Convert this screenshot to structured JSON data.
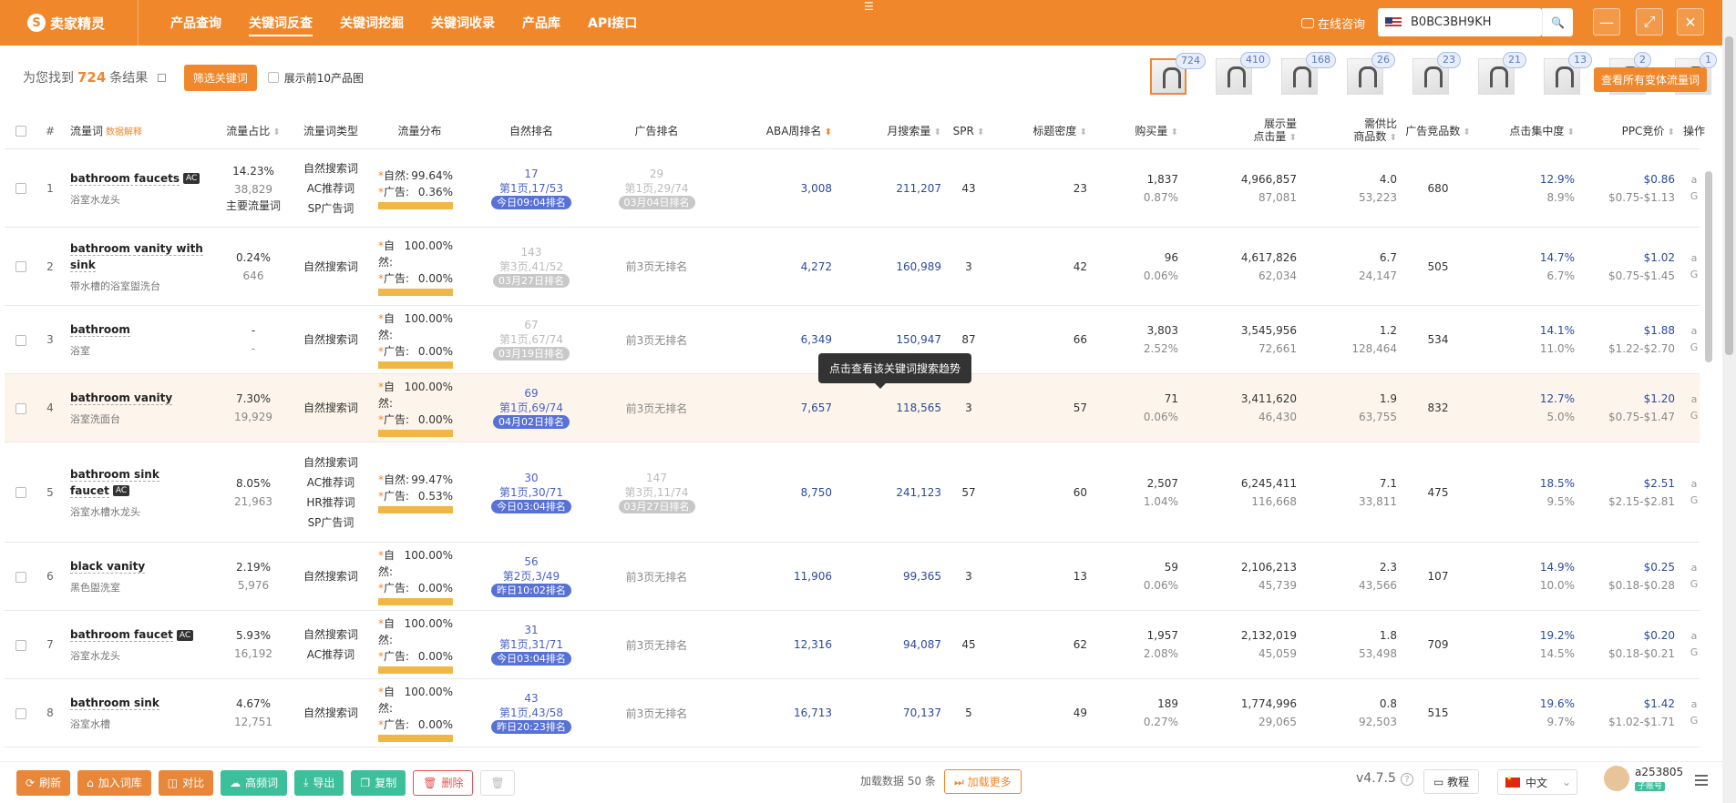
{
  "app": {
    "logo_text": "卖家精灵",
    "logo_mark": "S"
  },
  "nav": [
    {
      "label": "产品查询"
    },
    {
      "label": "关键词反查"
    },
    {
      "label": "关键词挖掘"
    },
    {
      "label": "关键词收录"
    },
    {
      "label": "产品库"
    },
    {
      "label": "API接口"
    }
  ],
  "topbar": {
    "consult": "在线咨询",
    "asin": "B0BC3BH9KH"
  },
  "summary": {
    "prefix": "为您找到",
    "count": "724",
    "suffix": "条结果",
    "filter_btn": "筛选关键词",
    "top10_label": "展示前10产品图",
    "view_all_btn": "查看所有变体流量词",
    "thumb_counts": [
      "724",
      "410",
      "168",
      "26",
      "23",
      "21",
      "13",
      "2",
      "1"
    ]
  },
  "headers": {
    "num": "#",
    "kw": "流量词",
    "kw_link": "数据解释",
    "share": "流量占比",
    "type": "流量词类型",
    "dist": "流量分布",
    "nat": "自然排名",
    "ad": "广告排名",
    "aba": "ABA周排名",
    "month": "月搜索量",
    "spr": "SPR",
    "title": "标题密度",
    "buy": "购买量",
    "imp1": "展示量",
    "imp2": "点击量",
    "supply1": "需供比",
    "supply2": "商品数",
    "adprod": "广告竞品数",
    "click": "点击集中度",
    "ppc": "PPC竞价",
    "op": "操作"
  },
  "dist_labels": {
    "nat": "自然:",
    "ad": "广告:"
  },
  "rows": [
    {
      "num": "1",
      "kw": "bathroom faucets",
      "ac": true,
      "kw_cn": "浴室水龙头",
      "share1": "14.23%",
      "share2": "38,829",
      "share3": "主要流量词",
      "types": [
        "自然搜索词",
        "AC推荐词",
        "SP广告词"
      ],
      "dist_nat": "99.64%",
      "dist_ad": "0.36%",
      "nat_rank": "17",
      "nat_page": "第1页,17/53",
      "nat_pill": "今日09:04排名",
      "ad_rank": "29",
      "ad_page": "第1页,29/74",
      "ad_pill": "03月04日排名",
      "ad_none": "",
      "aba": "3,008",
      "month": "211,207",
      "spr": "43",
      "title": "23",
      "buy1": "1,837",
      "buy2": "0.87%",
      "imp1": "4,966,857",
      "imp2": "87,081",
      "sup1": "4.0",
      "sup2": "53,223",
      "adprod": "680",
      "click1": "12.9%",
      "click2": "8.9%",
      "ppc1": "$0.86",
      "ppc2": "$0.75-$1.13"
    },
    {
      "num": "2",
      "kw": "bathroom vanity with sink",
      "ac": false,
      "kw_cn": "带水槽的浴室盥洗台",
      "share1": "0.24%",
      "share2": "646",
      "share3": "",
      "types": [
        "自然搜索词"
      ],
      "dist_nat": "100.00%",
      "dist_ad": "0.00%",
      "nat_rank": "143",
      "nat_page": "第3页,41/52",
      "nat_pill": "03月27日排名",
      "nat_grey": true,
      "ad_rank": "",
      "ad_page": "",
      "ad_pill": "",
      "ad_none": "前3页无排名",
      "aba": "4,272",
      "month": "160,989",
      "spr": "3",
      "title": "42",
      "buy1": "96",
      "buy2": "0.06%",
      "imp1": "4,617,826",
      "imp2": "62,034",
      "sup1": "6.7",
      "sup2": "24,147",
      "adprod": "505",
      "click1": "14.7%",
      "click2": "6.7%",
      "ppc1": "$1.02",
      "ppc2": "$0.75-$1.45"
    },
    {
      "num": "3",
      "kw": "bathroom",
      "ac": false,
      "kw_cn": "浴室",
      "share1": "-",
      "share2": "-",
      "share3": "",
      "types": [
        "自然搜索词"
      ],
      "dist_nat": "100.00%",
      "dist_ad": "0.00%",
      "nat_rank": "67",
      "nat_page": "第1页,67/74",
      "nat_pill": "03月19日排名",
      "nat_grey": true,
      "ad_rank": "",
      "ad_page": "",
      "ad_pill": "",
      "ad_none": "前3页无排名",
      "aba": "6,349",
      "month": "150,947",
      "spr": "87",
      "title": "66",
      "buy1": "3,803",
      "buy2": "2.52%",
      "imp1": "3,545,956",
      "imp2": "72,661",
      "sup1": "1.2",
      "sup2": "128,464",
      "adprod": "534",
      "click1": "14.1%",
      "click2": "11.0%",
      "ppc1": "$1.88",
      "ppc2": "$1.22-$2.70"
    },
    {
      "num": "4",
      "kw": "bathroom vanity",
      "ac": false,
      "kw_cn": "浴室洗面台",
      "share1": "7.30%",
      "share2": "19,929",
      "share3": "",
      "types": [
        "自然搜索词"
      ],
      "dist_nat": "100.00%",
      "dist_ad": "0.00%",
      "nat_rank": "69",
      "nat_page": "第1页,69/74",
      "nat_pill": "04月02日排名",
      "ad_rank": "",
      "ad_page": "",
      "ad_pill": "",
      "ad_none": "前3页无排名",
      "aba": "7,657",
      "month": "118,565",
      "spr": "3",
      "title": "57",
      "buy1": "71",
      "buy2": "0.06%",
      "imp1": "3,411,620",
      "imp2": "46,430",
      "sup1": "1.9",
      "sup2": "63,755",
      "adprod": "832",
      "click1": "12.7%",
      "click2": "5.0%",
      "ppc1": "$1.20",
      "ppc2": "$0.75-$1.47"
    },
    {
      "num": "5",
      "kw": "bathroom sink faucet",
      "ac": true,
      "kw_cn": "浴室水槽水龙头",
      "share1": "8.05%",
      "share2": "21,963",
      "share3": "",
      "types": [
        "自然搜索词",
        "AC推荐词",
        "HR推荐词",
        "SP广告词"
      ],
      "dist_nat": "99.47%",
      "dist_ad": "0.53%",
      "nat_rank": "30",
      "nat_page": "第1页,30/71",
      "nat_pill": "今日03:04排名",
      "ad_rank": "147",
      "ad_page": "第3页,11/74",
      "ad_pill": "03月27日排名",
      "ad_none": "",
      "aba": "8,750",
      "month": "241,123",
      "spr": "57",
      "title": "60",
      "buy1": "2,507",
      "buy2": "1.04%",
      "imp1": "6,245,411",
      "imp2": "116,668",
      "sup1": "7.1",
      "sup2": "33,811",
      "adprod": "475",
      "click1": "18.5%",
      "click2": "9.5%",
      "ppc1": "$2.51",
      "ppc2": "$2.15-$2.81"
    },
    {
      "num": "6",
      "kw": "black vanity",
      "ac": false,
      "kw_cn": "黑色盥洗室",
      "share1": "2.19%",
      "share2": "5,976",
      "share3": "",
      "types": [
        "自然搜索词"
      ],
      "dist_nat": "100.00%",
      "dist_ad": "0.00%",
      "nat_rank": "56",
      "nat_page": "第2页,3/49",
      "nat_pill": "昨日10:02排名",
      "ad_rank": "",
      "ad_page": "",
      "ad_pill": "",
      "ad_none": "前3页无排名",
      "aba": "11,906",
      "month": "99,365",
      "spr": "3",
      "title": "13",
      "buy1": "59",
      "buy2": "0.06%",
      "imp1": "2,106,213",
      "imp2": "45,739",
      "sup1": "2.3",
      "sup2": "43,566",
      "adprod": "107",
      "click1": "14.9%",
      "click2": "10.0%",
      "ppc1": "$0.25",
      "ppc2": "$0.18-$0.28"
    },
    {
      "num": "7",
      "kw": "bathroom faucet",
      "ac": true,
      "kw_cn": "浴室水龙头",
      "share1": "5.93%",
      "share2": "16,192",
      "share3": "",
      "types": [
        "自然搜索词",
        "AC推荐词"
      ],
      "dist_nat": "100.00%",
      "dist_ad": "0.00%",
      "nat_rank": "31",
      "nat_page": "第1页,31/71",
      "nat_pill": "今日03:04排名",
      "ad_rank": "",
      "ad_page": "",
      "ad_pill": "",
      "ad_none": "前3页无排名",
      "aba": "12,316",
      "month": "94,087",
      "spr": "45",
      "title": "62",
      "buy1": "1,957",
      "buy2": "2.08%",
      "imp1": "2,132,019",
      "imp2": "45,059",
      "sup1": "1.8",
      "sup2": "53,498",
      "adprod": "709",
      "click1": "19.2%",
      "click2": "14.5%",
      "ppc1": "$0.20",
      "ppc2": "$0.18-$0.21"
    },
    {
      "num": "8",
      "kw": "bathroom sink",
      "ac": false,
      "kw_cn": "浴室水槽",
      "share1": "4.67%",
      "share2": "12,751",
      "share3": "",
      "types": [
        "自然搜索词"
      ],
      "dist_nat": "100.00%",
      "dist_ad": "0.00%",
      "nat_rank": "43",
      "nat_page": "第1页,43/58",
      "nat_pill": "昨日20:23排名",
      "ad_rank": "",
      "ad_page": "",
      "ad_pill": "",
      "ad_none": "前3页无排名",
      "aba": "16,713",
      "month": "70,137",
      "spr": "5",
      "title": "49",
      "buy1": "189",
      "buy2": "0.27%",
      "imp1": "1,774,996",
      "imp2": "29,065",
      "sup1": "0.8",
      "sup2": "92,503",
      "adprod": "515",
      "click1": "19.6%",
      "click2": "9.7%",
      "ppc1": "$1.42",
      "ppc2": "$1.02-$1.71"
    }
  ],
  "tooltip": "点击查看该关键词搜索趋势",
  "bottom": {
    "refresh": "刷新",
    "add_lib": "加入词库",
    "compare": "对比",
    "high_freq": "高频词",
    "export": "导出",
    "copy": "复制",
    "delete": "删除",
    "loaded": "加载数据 50 条",
    "load_more": "加载更多",
    "version": "v4.7.5",
    "tutorial": "教程",
    "lang": "中文",
    "user": "a253805",
    "user_tag": "子账号"
  },
  "colors": {
    "brand": "#f0882b",
    "pill": "#5871d6",
    "bar": "#f0b646"
  }
}
